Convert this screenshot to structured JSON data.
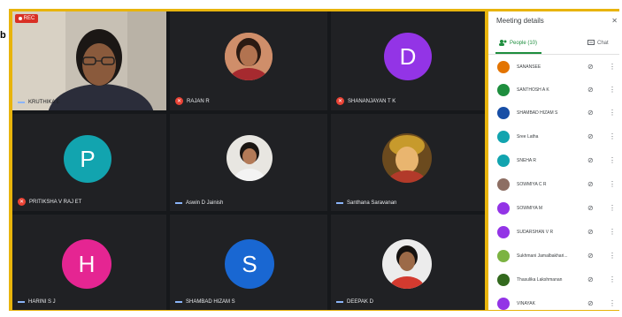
{
  "outside_letter": "b",
  "recording": {
    "label": "REC"
  },
  "tiles": [
    {
      "name": "KRUTHIKA E",
      "muted": false,
      "kind": "video"
    },
    {
      "name": "RAJAN R",
      "muted": true,
      "kind": "photo"
    },
    {
      "name": "SHANANJAYAN T K",
      "muted": true,
      "kind": "letter",
      "letter": "D",
      "color": "#9334e6"
    },
    {
      "name": "PRITIKSHA V RAJ ET",
      "muted": true,
      "kind": "letter",
      "letter": "P",
      "color": "#12a4af"
    },
    {
      "name": "Aswin D Jainish",
      "muted": false,
      "kind": "photo"
    },
    {
      "name": "Santhana Saravanan",
      "muted": false,
      "kind": "photo"
    },
    {
      "name": "HARINI S J",
      "muted": false,
      "kind": "letter",
      "letter": "H",
      "color": "#e52592"
    },
    {
      "name": "SHAMBAD HIZAM S",
      "muted": false,
      "kind": "letter",
      "letter": "S",
      "color": "#1967d2"
    },
    {
      "name": "DEEPAK D",
      "muted": false,
      "kind": "photo"
    }
  ],
  "panel": {
    "title": "Meeting details",
    "close_icon": "close-icon",
    "tabs": [
      {
        "label": "People (10)",
        "icon": "people-icon",
        "active": true
      },
      {
        "label": "Chat",
        "icon": "chat-icon",
        "active": false
      }
    ],
    "people": [
      {
        "name": "SANANSEE",
        "color": "#e37400"
      },
      {
        "name": "SANTHOSH A K",
        "color": "#1e8e3e"
      },
      {
        "name": "SHAMBAD HIZAM S",
        "color": "#174ea6"
      },
      {
        "name": "Sree Latha",
        "color": "#12a4af"
      },
      {
        "name": "SNEHA R",
        "color": "#12a4af"
      },
      {
        "name": "SOWMIYA C R",
        "color": "#8d6e63"
      },
      {
        "name": "SOWMIYA M",
        "color": "#9334e6"
      },
      {
        "name": "SUDARSHAN V R",
        "color": "#9334e6"
      },
      {
        "name": "Sukhmani Jamalbakhari...",
        "color": "#7cb342"
      },
      {
        "name": "Thasulika Lakshmanan",
        "color": "#33691e"
      },
      {
        "name": "VINAYAK",
        "color": "#9334e6"
      }
    ]
  }
}
